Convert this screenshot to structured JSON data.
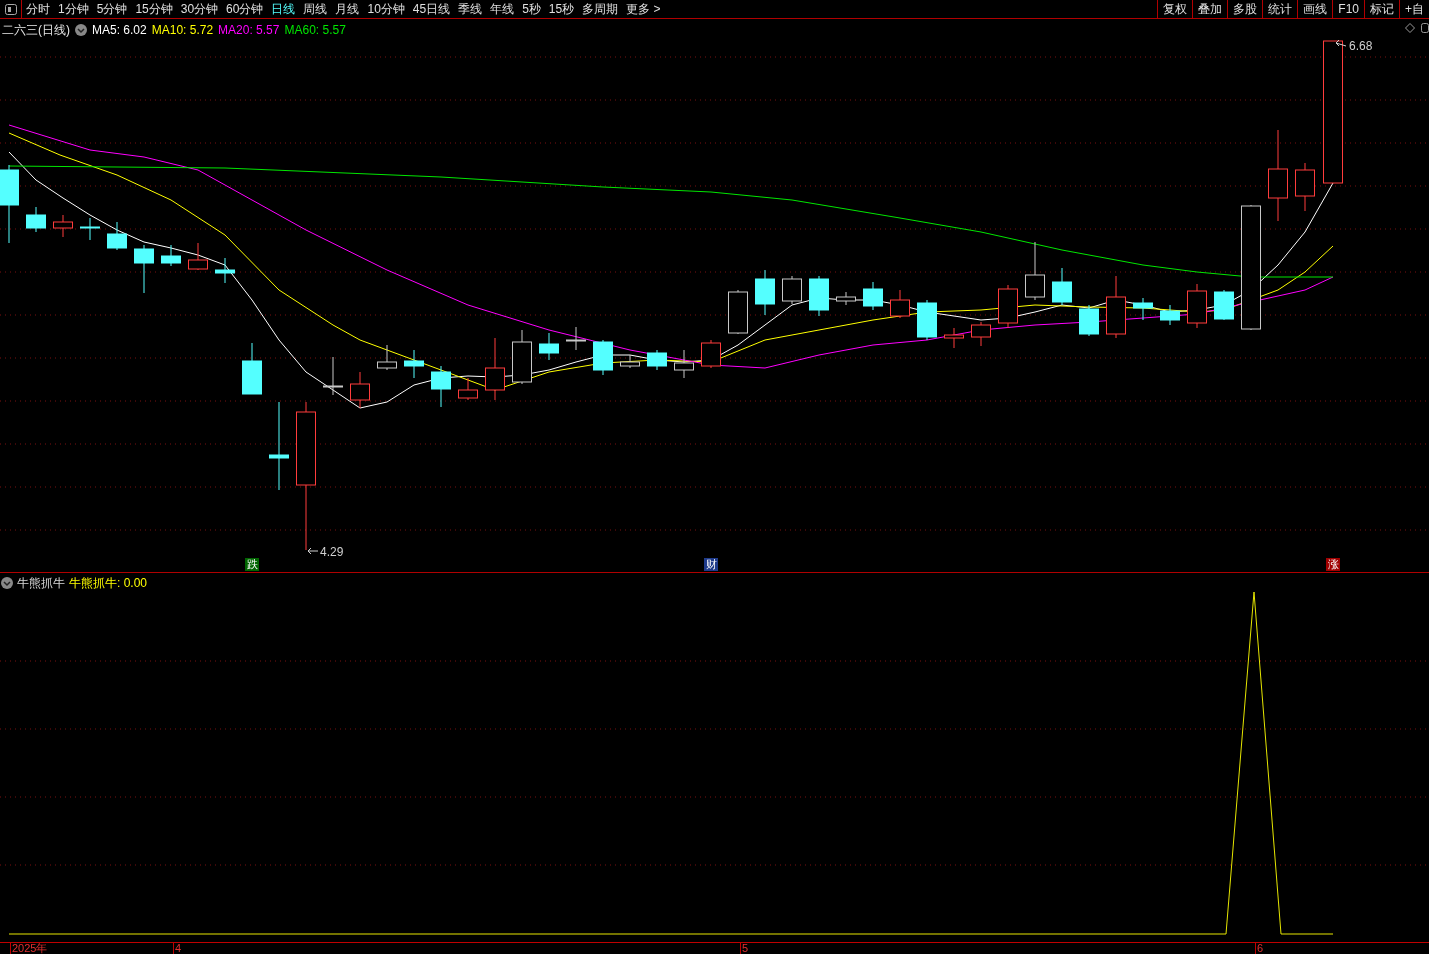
{
  "toolbar": {
    "periods": [
      {
        "label": "分时",
        "selected": false
      },
      {
        "label": "1分钟",
        "selected": false
      },
      {
        "label": "5分钟",
        "selected": false
      },
      {
        "label": "15分钟",
        "selected": false
      },
      {
        "label": "30分钟",
        "selected": false
      },
      {
        "label": "60分钟",
        "selected": false
      },
      {
        "label": "日线",
        "selected": true
      },
      {
        "label": "周线",
        "selected": false
      },
      {
        "label": "月线",
        "selected": false
      },
      {
        "label": "10分钟",
        "selected": false
      },
      {
        "label": "45日线",
        "selected": false
      },
      {
        "label": "季线",
        "selected": false
      },
      {
        "label": "年线",
        "selected": false
      },
      {
        "label": "5秒",
        "selected": false
      },
      {
        "label": "15秒",
        "selected": false
      },
      {
        "label": "多周期",
        "selected": false
      },
      {
        "label": "更多 >",
        "selected": false
      }
    ],
    "tools": [
      "复权",
      "叠加",
      "多股",
      "统计",
      "画线",
      "F10",
      "标记",
      "+自"
    ]
  },
  "main_chart": {
    "title": "二六三(日线)",
    "moving_averages": [
      {
        "label": "MA5: 6.02",
        "color": "#ffffff"
      },
      {
        "label": "MA10: 5.72",
        "color": "#ffff00"
      },
      {
        "label": "MA20: 5.57",
        "color": "#ff00ff"
      },
      {
        "label": "MA60: 5.57",
        "color": "#00e600"
      }
    ],
    "high_label": "6.68",
    "low_label": "4.29",
    "events": [
      {
        "label": "跌",
        "color": "#006400"
      },
      {
        "label": "财",
        "color": "#1e3a8a"
      },
      {
        "label": "涨",
        "color": "#a00000"
      }
    ]
  },
  "indicator": {
    "name": "牛熊抓牛",
    "value_label": "牛熊抓牛: 0.00"
  },
  "time_axis": [
    "2025年",
    "4",
    "5",
    "6"
  ]
}
